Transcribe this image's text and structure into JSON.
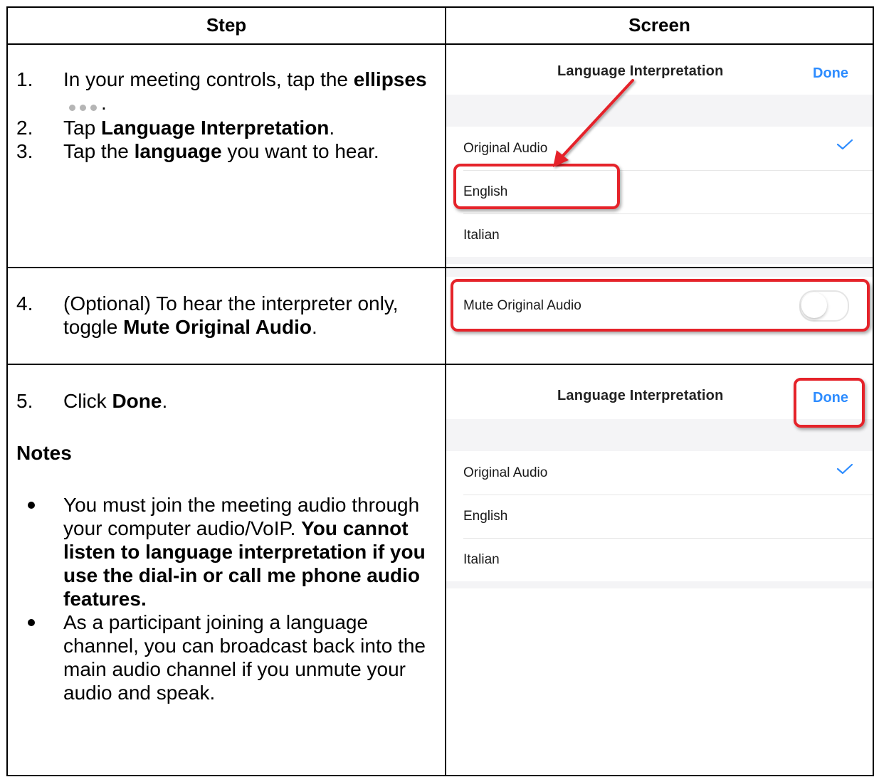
{
  "table": {
    "header_step": "Step",
    "header_screen": "Screen"
  },
  "row1": {
    "items": [
      {
        "num": "1.",
        "pre": "In your meeting controls, tap the ",
        "bold": "ellipses",
        "post": "."
      },
      {
        "num": "2.",
        "pre": "Tap ",
        "bold": "Language Interpretation",
        "post": "."
      },
      {
        "num": "3.",
        "pre": "Tap the ",
        "bold": "language",
        "post": " you want to hear."
      }
    ]
  },
  "row2": {
    "num": "4.",
    "pre": "(Optional) To hear the interpreter only, toggle ",
    "bold": "Mute Original Audio",
    "post": "."
  },
  "row3": {
    "num": "5.",
    "pre": "Click ",
    "bold": "Done",
    "post": ".",
    "notes_heading": "Notes",
    "bullets": [
      {
        "text": "You must join the meeting audio through your computer audio/VoIP.",
        "bold": "You cannot listen to language interpretation if you use the dial-in or call me phone audio features."
      },
      {
        "text": "As a participant joining a language channel, you can broadcast back into the main audio channel if you unmute your audio and speak.",
        "bold": ""
      }
    ]
  },
  "screen1": {
    "title": "Language Interpretation",
    "done": "Done",
    "options": [
      "Original Audio",
      "English",
      "Italian"
    ],
    "selected": "Original Audio"
  },
  "screen2": {
    "label": "Mute Original Audio",
    "toggle_on": false
  },
  "screen3": {
    "title": "Language Interpretation",
    "done": "Done",
    "options": [
      "Original Audio",
      "English",
      "Italian"
    ],
    "selected": "Original Audio"
  },
  "colors": {
    "accent_blue": "#2d8cff",
    "highlight_red": "#e5232a"
  }
}
